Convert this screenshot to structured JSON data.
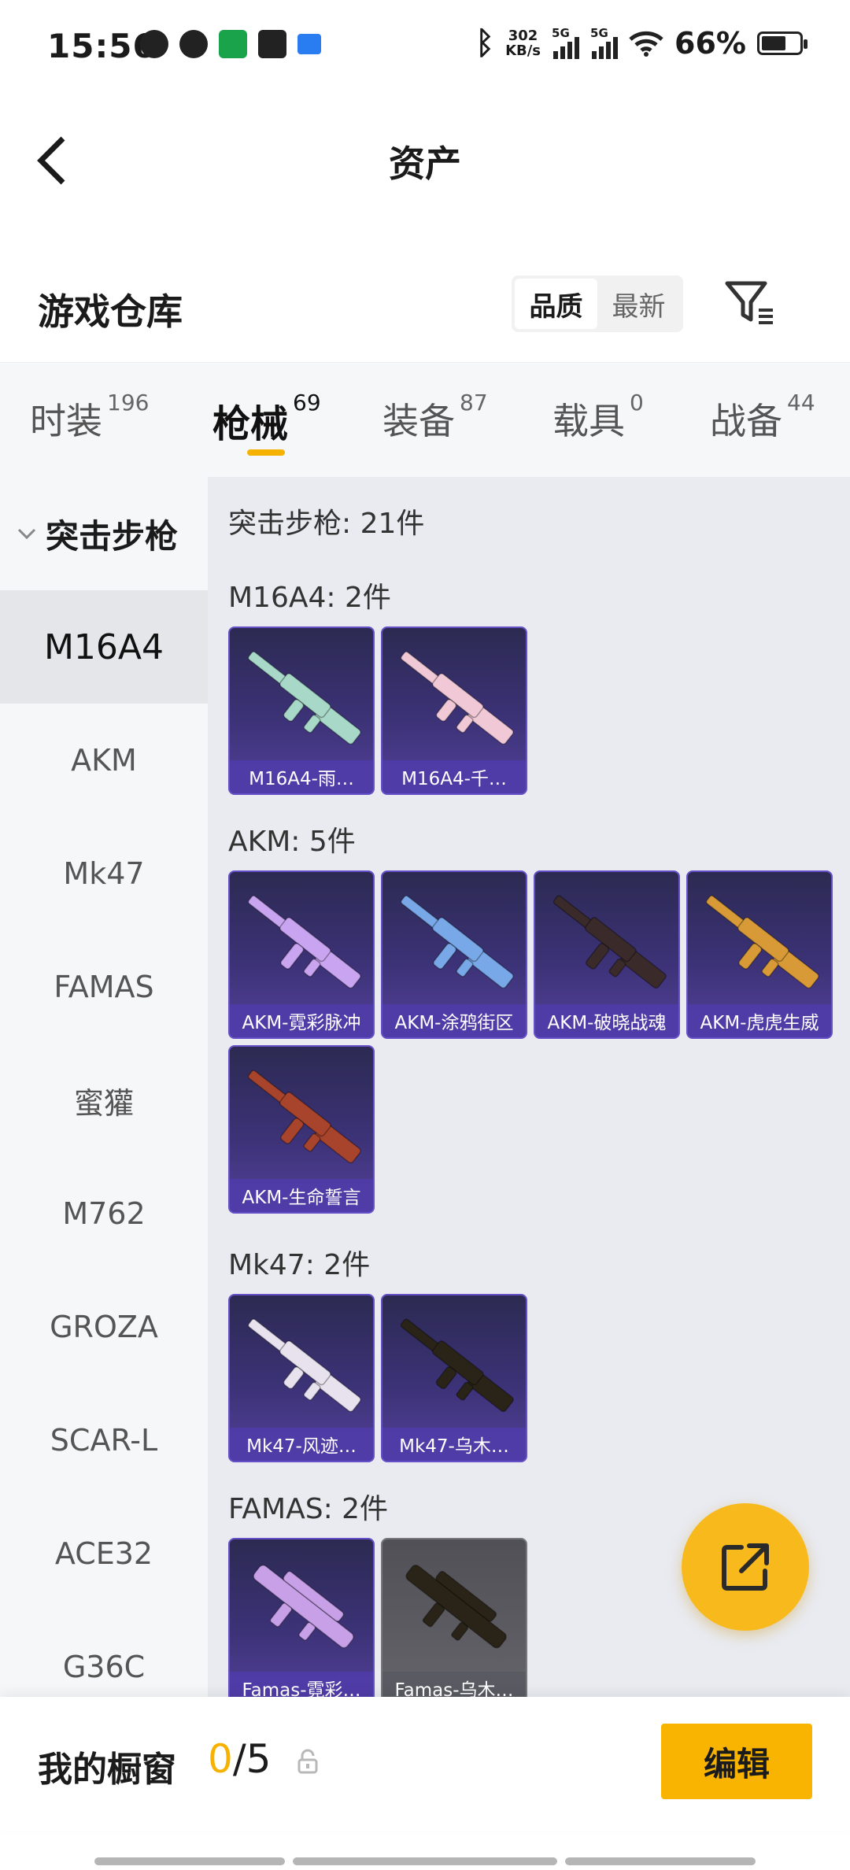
{
  "status_bar": {
    "time": "15:56",
    "net_speed_value": "302",
    "net_speed_unit": "KB/s",
    "signal1_label": "5G",
    "signal2_label": "5G",
    "battery_percent": "66%",
    "battery_level": 0.66
  },
  "header": {
    "title": "资产"
  },
  "warehouse": {
    "title": "游戏仓库",
    "sort_options": [
      "品质",
      "最新"
    ],
    "sort_selected": "品质"
  },
  "category_tabs": [
    {
      "name": "时装",
      "count": "196"
    },
    {
      "name": "枪械",
      "count": "69",
      "active": true
    },
    {
      "name": "装备",
      "count": "87"
    },
    {
      "name": "载具",
      "count": "0"
    },
    {
      "name": "战备",
      "count": "44"
    }
  ],
  "sidebar": {
    "section_title": "突击步枪",
    "items": [
      "M16A4",
      "AKM",
      "Mk47",
      "FAMAS",
      "蜜獾",
      "M762",
      "GROZA",
      "SCAR-L",
      "ACE32",
      "G36C"
    ],
    "active_item": "M16A4"
  },
  "main": {
    "total_label": "突击步枪: 21件",
    "groups": [
      {
        "label": "M16A4: 2件",
        "items": [
          {
            "name": "M16A4-雨…",
            "gun_color": "#a8d8c8"
          },
          {
            "name": "M16A4-千…",
            "gun_color": "#f0c8d6"
          }
        ]
      },
      {
        "label": "AKM: 5件",
        "items": [
          {
            "name": "AKM-霓彩脉冲",
            "gun_color": "#c9a4f0"
          },
          {
            "name": "AKM-涂鸦街区",
            "gun_color": "#78a8e8"
          },
          {
            "name": "AKM-破晓战魂",
            "gun_color": "#3a2a2a"
          },
          {
            "name": "AKM-虎虎生威",
            "gun_color": "#d89a36"
          },
          {
            "name": "AKM-生命誓言",
            "gun_color": "#a8442c"
          }
        ]
      },
      {
        "label": "Mk47: 2件",
        "items": [
          {
            "name": "Mk47-风迹…",
            "gun_color": "#e8e2ee"
          },
          {
            "name": "Mk47-乌木…",
            "gun_color": "#2a2418"
          }
        ]
      },
      {
        "label": "FAMAS: 2件",
        "items": [
          {
            "name": "Famas-霓彩…",
            "gun_color": "#c8a0e8"
          },
          {
            "name": "Famas-乌木…",
            "gun_color": "#2a2418"
          }
        ]
      }
    ]
  },
  "bottom_bar": {
    "window_label": "我的橱窗",
    "window_current": "0",
    "window_total": "/5",
    "edit_label": "编辑"
  },
  "colors": {
    "accent": "#f8b400",
    "card_border": "#6550c8",
    "card_bg": "#3c3277"
  }
}
